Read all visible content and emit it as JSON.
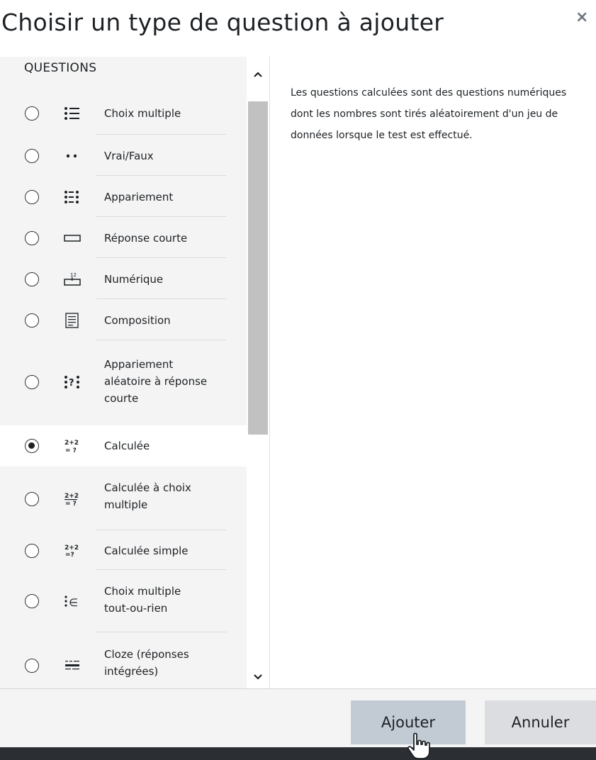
{
  "dialog": {
    "title": "Choisir un type de question à ajouter",
    "close_glyph": "×"
  },
  "question_list": {
    "section_label": "QUESTIONS",
    "items": [
      {
        "label": "Choix multiple",
        "icon": "multichoice-icon",
        "selected": false
      },
      {
        "label": "Vrai/Faux",
        "icon": "truefalse-icon",
        "selected": false
      },
      {
        "label": "Appariement",
        "icon": "match-icon",
        "selected": false
      },
      {
        "label": "Réponse courte",
        "icon": "shortanswer-icon",
        "selected": false
      },
      {
        "label": "Numérique",
        "icon": "numerical-icon",
        "selected": false
      },
      {
        "label": "Composition",
        "icon": "essay-icon",
        "selected": false
      },
      {
        "label": "Appariement aléatoire à réponse courte",
        "icon": "randomsamatch-icon",
        "selected": false
      },
      {
        "label": "Calculée",
        "icon": "calculated-icon",
        "selected": true
      },
      {
        "label": "Calculée à choix multiple",
        "icon": "calculatedmulti-icon",
        "selected": false
      },
      {
        "label": "Calculée simple",
        "icon": "calculatedsimple-icon",
        "selected": false
      },
      {
        "label": "Choix multiple tout-ou-rien",
        "icon": "oumultiresponse-icon",
        "selected": false
      },
      {
        "label": "Cloze (réponses intégrées)",
        "icon": "multianswer-icon",
        "selected": false
      }
    ]
  },
  "description": {
    "text": "Les questions calculées sont des questions numériques dont les nombres sont tirés aléatoirement d'un jeu de données lorsque le test est effectué."
  },
  "footer": {
    "add_label": "Ajouter",
    "cancel_label": "Annuler"
  },
  "colors": {
    "add_button_bg": "#c2cbd4",
    "cancel_button_bg": "#dcdde0",
    "list_bg": "#f4f4f4",
    "scrollbar_thumb": "#c1c1c1"
  }
}
